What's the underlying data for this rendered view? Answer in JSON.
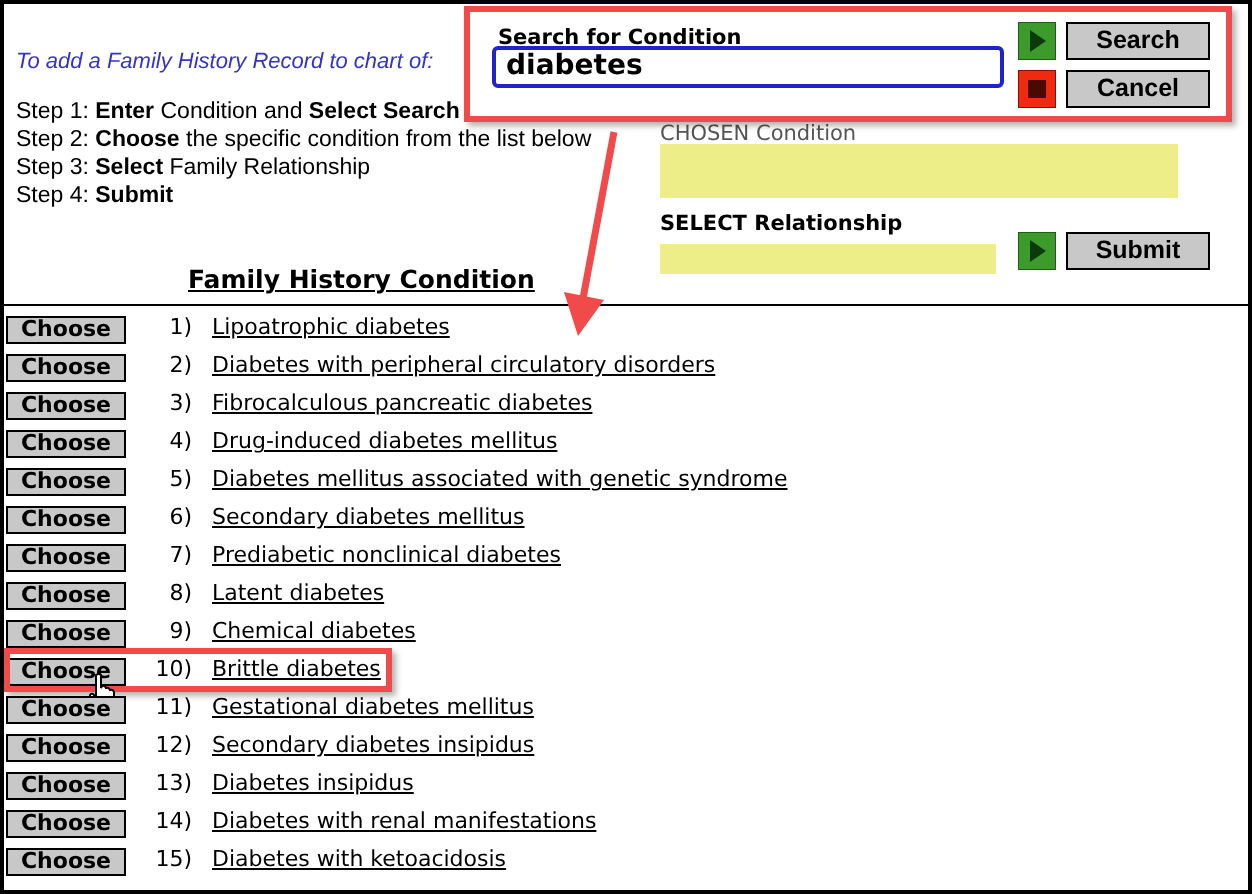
{
  "intro": "To add a Family History Record to chart of:",
  "steps": [
    "Step 1: **Enter** Condition and **Select Search**",
    "Step 2: **Choose** the specific condition from the list below",
    "Step 3: **Select** Family Relationship",
    "Step 4: **Submit**"
  ],
  "search": {
    "label": "Search for Condition",
    "value": "diabetes",
    "search_button": "Search",
    "cancel_button": "Cancel"
  },
  "chosen": {
    "label": "CHOSEN Condition"
  },
  "relationship": {
    "label": "SELECT Relationship",
    "submit_button": "Submit"
  },
  "list_title": "Family History Condition",
  "conditions": [
    {
      "button": "Choose",
      "number": "1)",
      "name": "Lipoatrophic diabetes",
      "highlighted": false
    },
    {
      "button": "Choose",
      "number": "2)",
      "name": "Diabetes with peripheral circulatory disorders",
      "highlighted": false
    },
    {
      "button": "Choose",
      "number": "3)",
      "name": "Fibrocalculous pancreatic diabetes",
      "highlighted": false
    },
    {
      "button": "Choose",
      "number": "4)",
      "name": "Drug-induced diabetes mellitus",
      "highlighted": false
    },
    {
      "button": "Choose",
      "number": "5)",
      "name": "Diabetes mellitus associated with genetic syndrome",
      "highlighted": false
    },
    {
      "button": "Choose",
      "number": "6)",
      "name": "Secondary diabetes mellitus",
      "highlighted": false
    },
    {
      "button": "Choose",
      "number": "7)",
      "name": "Prediabetic nonclinical diabetes",
      "highlighted": false
    },
    {
      "button": "Choose",
      "number": "8)",
      "name": "Latent diabetes",
      "highlighted": false
    },
    {
      "button": "Choose",
      "number": "9)",
      "name": "Chemical diabetes",
      "highlighted": false
    },
    {
      "button": "Choose",
      "number": "10)",
      "name": "Brittle diabetes",
      "highlighted": true
    },
    {
      "button": "Choose",
      "number": "11)",
      "name": "Gestational diabetes mellitus",
      "highlighted": false
    },
    {
      "button": "Choose",
      "number": "12)",
      "name": "Secondary diabetes insipidus",
      "highlighted": false
    },
    {
      "button": "Choose",
      "number": "13)",
      "name": "Diabetes insipidus",
      "highlighted": false
    },
    {
      "button": "Choose",
      "number": "14)",
      "name": "Diabetes with renal manifestations",
      "highlighted": false
    },
    {
      "button": "Choose",
      "number": "15)",
      "name": "Diabetes with ketoacidosis",
      "highlighted": false
    }
  ]
}
